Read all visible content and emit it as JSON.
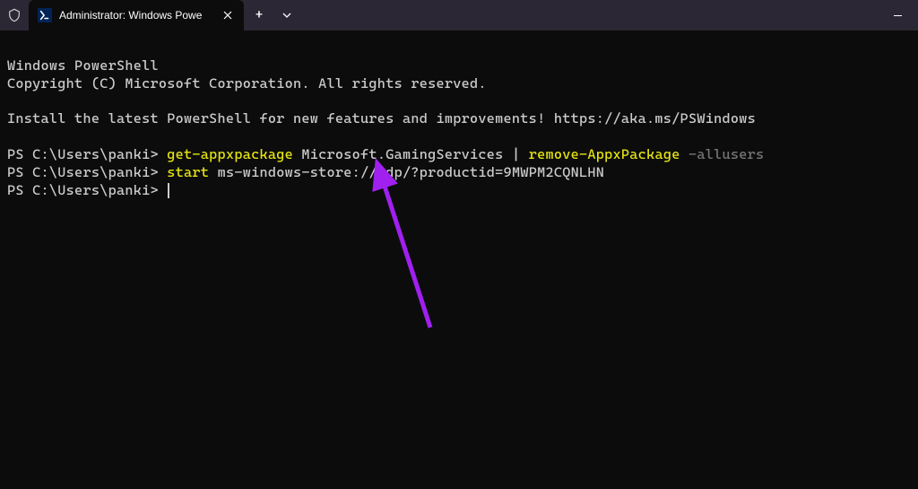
{
  "titlebar": {
    "tab_title": "Administrator: Windows Powe",
    "close_glyph": "✕",
    "plus_glyph": "+",
    "minimize_glyph": "—"
  },
  "terminal": {
    "line1": "Windows PowerShell",
    "line2": "Copyright (C) Microsoft Corporation. All rights reserved.",
    "line3": "",
    "line4": "Install the latest PowerShell for new features and improvements! https://aka.ms/PSWindows",
    "line5": "",
    "prompt": "PS C:\\Users\\panki> ",
    "cmd1_a": "get-appxpackage",
    "cmd1_b": " Microsoft.GamingServices ",
    "cmd1_c": "|",
    "cmd1_d": " ",
    "cmd1_e": "remove-AppxPackage",
    "cmd1_f": " ",
    "cmd1_g": "-allusers",
    "cmd2_a": "start",
    "cmd2_b": " ms-windows-store://pdp/?productid=9MWPM2CQNLHN"
  },
  "colors": {
    "yellow": "#e5e510",
    "gray": "#767676",
    "arrow": "#a020f0"
  }
}
